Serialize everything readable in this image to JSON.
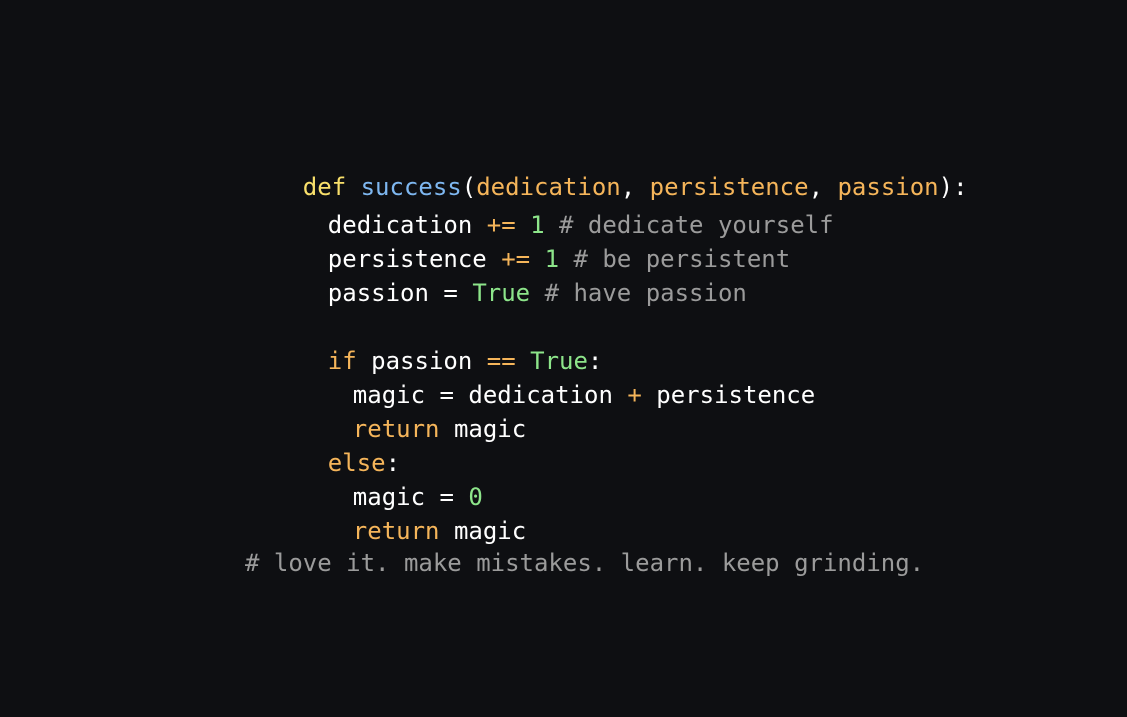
{
  "code": {
    "line1": {
      "def": "def",
      "fn_name": "success",
      "open_paren": "(",
      "p1": "dedication",
      "comma1": ", ",
      "p2": "persistence",
      "comma2": ", ",
      "p3": "passion",
      "close": "):"
    },
    "line2": {
      "var": "dedication",
      "op": "+=",
      "num": "1",
      "comment": "# dedicate yourself"
    },
    "line3": {
      "var": "persistence",
      "op": "+=",
      "num": "1",
      "comment": "# be persistent"
    },
    "line4": {
      "var": "passion",
      "op": "=",
      "val": "True",
      "comment": "# have passion"
    },
    "line5": {
      "kw": "if",
      "var": "passion",
      "op": "==",
      "val": "True",
      "colon": ":"
    },
    "line6": {
      "var": "magic",
      "eq": "=",
      "a": "dedication",
      "plus": "+",
      "b": "persistence"
    },
    "line7": {
      "kw": "return",
      "var": "magic"
    },
    "line8": {
      "kw": "else",
      "colon": ":"
    },
    "line9": {
      "var": "magic",
      "eq": "=",
      "num": "0"
    },
    "line10": {
      "kw": "return",
      "var": "magic"
    }
  },
  "footer": {
    "comment": "# love it. make mistakes. learn. keep grinding."
  },
  "colors": {
    "background": "#0e0f12",
    "keyword_def": "#f9e06b",
    "function_name": "#7eb7f0",
    "parameter": "#f5b55a",
    "number_bool": "#8de58a",
    "comment": "#9b9b9b",
    "text": "#ffffff"
  }
}
